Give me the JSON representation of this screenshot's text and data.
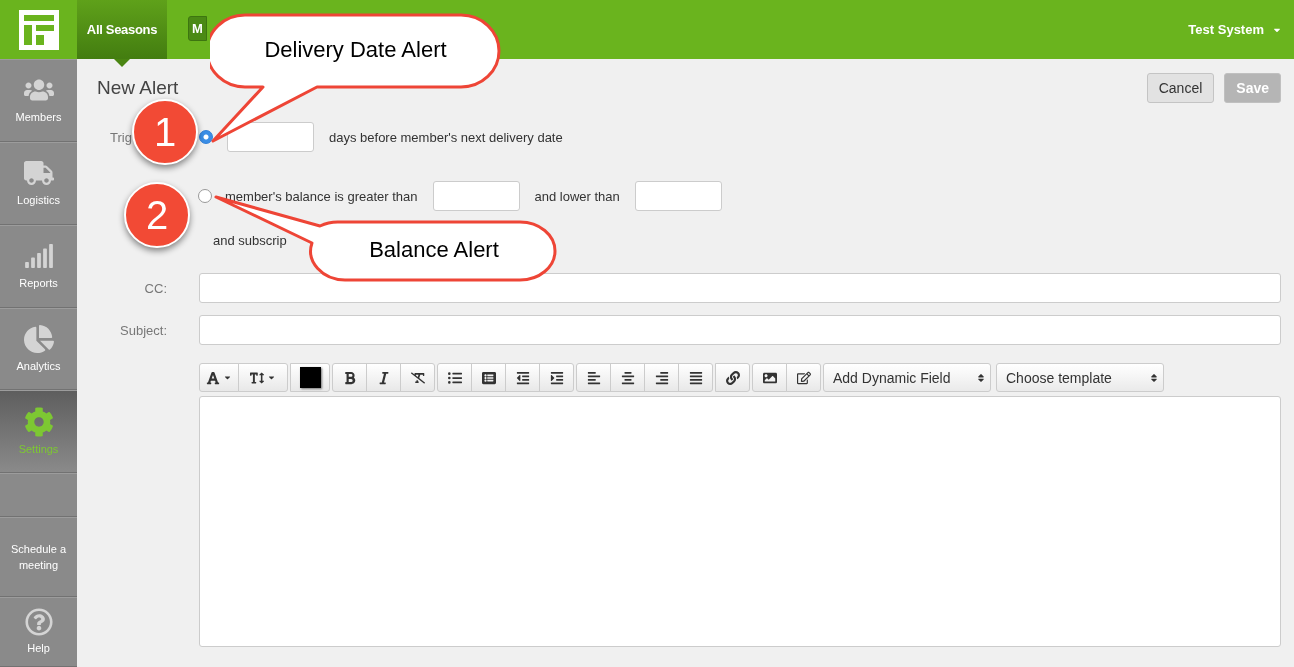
{
  "top_bar": {
    "season_tab": {
      "label": "All Seasons",
      "selected": true
    },
    "menu_button": {
      "label": "M"
    },
    "user_menu": {
      "label": "Test System"
    }
  },
  "sidebar": {
    "items": [
      {
        "label": "Members",
        "selected": false
      },
      {
        "label": "Logistics",
        "selected": false
      },
      {
        "label": "Reports",
        "selected": false
      },
      {
        "label": "Analytics",
        "selected": false
      },
      {
        "label": "Settings",
        "selected": true
      },
      {
        "selected": false
      },
      {
        "label": "Schedule a meeting",
        "selected": false
      },
      {
        "label": "Help",
        "selected": false
      }
    ]
  },
  "page": {
    "title": "New Alert",
    "buttons": [
      {
        "label": "Cancel",
        "disabled": false
      },
      {
        "label": "Save",
        "disabled": true
      }
    ]
  },
  "trigger": {
    "label": "Trig",
    "options": [
      {
        "selected": true,
        "text": "days before member's next delivery date"
      },
      {
        "selected": false,
        "text": "member's balance is greater than",
        "text_2": "and lower than"
      }
    ],
    "subscription_text": "and subscrip"
  },
  "cc": {
    "label": "CC:"
  },
  "subject": {
    "label": "Subject:"
  },
  "editor": {
    "color_button": {
      "color": "#000000"
    },
    "dynamic_field": "Add Dynamic Field",
    "template": "Choose template"
  },
  "callouts": [
    {
      "number": "1",
      "text": "Delivery Date Alert"
    },
    {
      "number": "2",
      "text": "Balance Alert"
    }
  ]
}
